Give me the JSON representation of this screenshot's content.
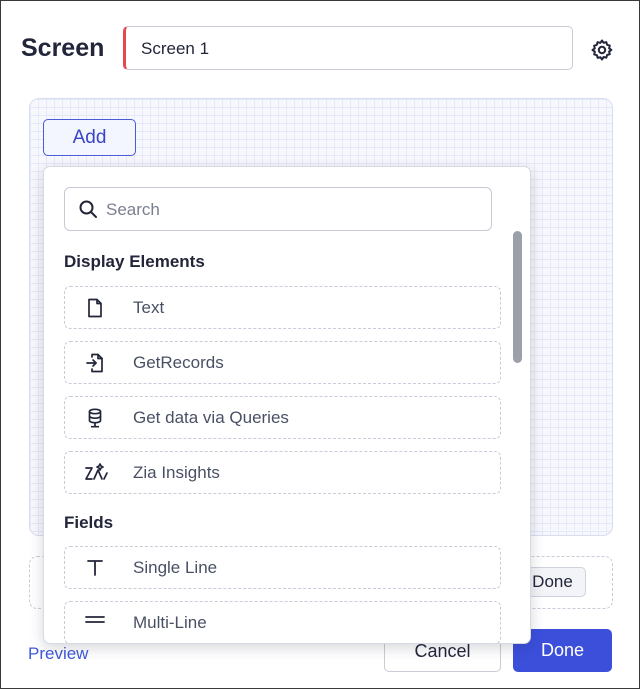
{
  "header": {
    "title": "Screen",
    "name_value": "Screen 1"
  },
  "canvas": {
    "add_label": "Add"
  },
  "dropdown": {
    "search_placeholder": "Search",
    "sections": [
      {
        "title": "Display Elements",
        "items": [
          {
            "label": "Text",
            "icon": "document-icon"
          },
          {
            "label": "GetRecords",
            "icon": "import-records-icon"
          },
          {
            "label": "Get data via Queries",
            "icon": "database-icon"
          },
          {
            "label": "Zia Insights",
            "icon": "zia-insights-icon"
          }
        ]
      },
      {
        "title": "Fields",
        "items": [
          {
            "label": "Single Line",
            "icon": "text-t-icon"
          },
          {
            "label": "Multi-Line",
            "icon": "multi-line-icon"
          }
        ]
      }
    ]
  },
  "footer": {
    "inner_done_label": "Done",
    "preview_label": "Preview",
    "cancel_label": "Cancel",
    "done_label": "Done"
  },
  "colors": {
    "accent": "#3b4fdb",
    "required_marker": "#e5484d",
    "link": "#3f5ad8"
  }
}
